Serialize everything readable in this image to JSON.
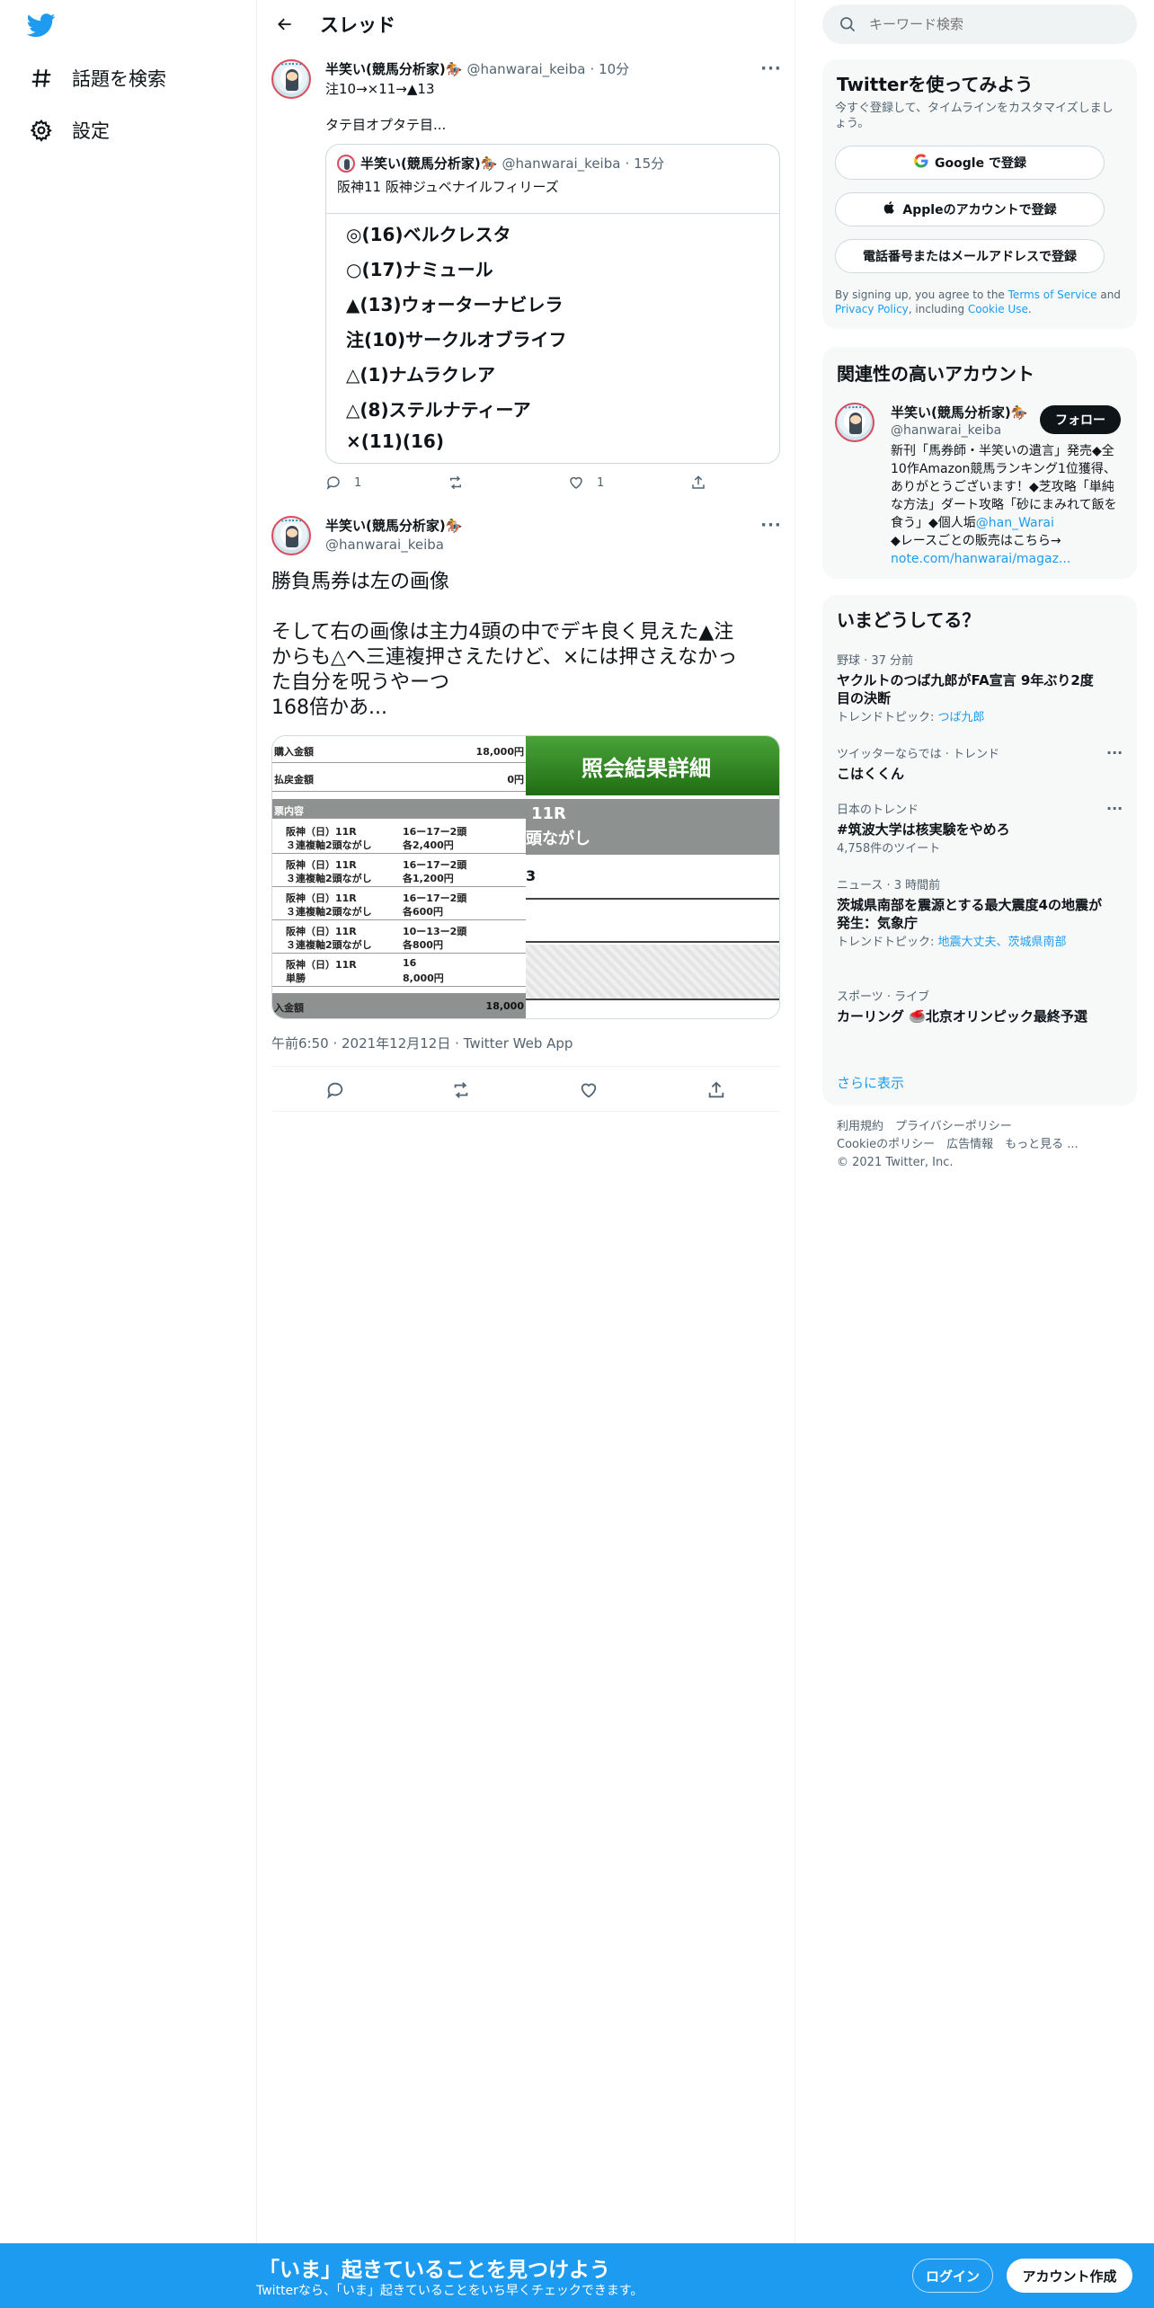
{
  "nav": {
    "explore_label": "話題を検索",
    "settings_label": "設定"
  },
  "header": {
    "title": "スレッド"
  },
  "tweet1": {
    "display_name": "半笑い(競馬分析家)🏇",
    "handle": "@hanwarai_keiba",
    "time": "· 10分",
    "line1": "注10→×11→▲13",
    "line2": "タテ目オプタテ目...",
    "reply_count": "1",
    "like_count": "1",
    "quote": {
      "display_name": "半笑い(競馬分析家)🏇",
      "handle": "@hanwarai_keiba",
      "time": "· 15分",
      "text": "阪神11 阪神ジュベナイルフィリーズ",
      "picks": [
        "◎(16)ベルクレスタ",
        "○(17)ナミュール",
        "▲(13)ウォーターナビレラ",
        "注(10)サークルオブライフ",
        "△(1)ナムラクレア",
        "△(8)ステルナティーア",
        "×(11)(16)"
      ]
    }
  },
  "tweet2": {
    "display_name": "半笑い(競馬分析家)🏇",
    "handle": "@hanwarai_keiba",
    "body": [
      "勝負馬券は左の画像",
      "",
      "そして右の画像は主力4頭の中でデキ良く見えた▲注",
      "からも△へ三連複押さえたけど、×には押さえなかっ",
      "た自分を呪うやーつ",
      "168倍かあ..."
    ],
    "timestamp": "午前6:50 · 2021年12月12日 · Twitter Web App",
    "media": {
      "left": {
        "purchase_label": "購入金額",
        "purchase_value": "18,000円",
        "payout_label": "払戻金額",
        "payout_value": "0円",
        "section_label": "票内容",
        "rows": [
          {
            "race": "阪神（日）11R",
            "bet": "３連複軸2頭ながし",
            "combo": "16ー17ー2頭",
            "amount": "各2,400円"
          },
          {
            "race": "阪神（日）11R",
            "bet": "３連複軸2頭ながし",
            "combo": "16ー17ー2頭",
            "amount": "各1,200円"
          },
          {
            "race": "阪神（日）11R",
            "bet": "３連複軸2頭ながし",
            "combo": "16ー17ー2頭",
            "amount": "各600円"
          },
          {
            "race": "阪神（日）11R",
            "bet": "３連複軸2頭ながし",
            "combo": "10ー13ー2頭",
            "amount": "各800円"
          },
          {
            "race": "阪神（日）11R",
            "bet": "単勝",
            "combo": "16",
            "amount": "8,000円"
          }
        ],
        "total_label": "入金額",
        "total_value": "18,000"
      },
      "right": {
        "title": "照会結果詳細",
        "line1": "11R",
        "line2": "頭ながし",
        "cell": "3"
      }
    }
  },
  "sidebar": {
    "search_placeholder": "キーワード検索",
    "signup": {
      "title": "Twitterを使ってみよう",
      "desc": "今すぐ登録して、タイムラインをカスタマイズしましょう。",
      "google": "Google で登録",
      "apple": "Appleのアカウントで登録",
      "phone": "電話番号またはメールアドレスで登録",
      "legal_pre": "By signing up, you agree to the ",
      "legal_terms": "Terms of Service",
      "legal_mid": " and ",
      "legal_privacy": "Privacy Policy",
      "legal_mid2": ", including ",
      "legal_cookie": "Cookie Use",
      "legal_end": "."
    },
    "related": {
      "title": "関連性の高いアカウント",
      "display_name": "半笑い(競馬分析家)🏇",
      "handle": "@hanwarai_keiba",
      "follow": "フォロー",
      "bio1": "新刊「馬券師・半笑いの遺言」発売◆全10作Amazon競馬ランキング1位獲得、ありがとうございます！◆芝攻略「単純な方法」ダート攻略「砂にまみれて飯を食う」◆個人垢",
      "bio_link": "@han_Warai",
      "bio2": "◆レースごとの販売はこちら→",
      "bio_url": "note.com/hanwarai/magaz..."
    },
    "trends": {
      "title": "いまどうしてる？",
      "items": [
        {
          "cat": "野球 · 37 分前",
          "title": "ヤクルトのつば九郎がFA宣言 9年ぶり2度目の決断",
          "sub_pre": "トレンドトピック: ",
          "sub_links": "つば九郎"
        },
        {
          "cat": "ツイッターならでは · トレンド",
          "title": "こはくくん"
        },
        {
          "cat": "日本のトレンド",
          "title": "#筑波大学は核実験をやめろ",
          "sub": "4,758件のツイート"
        },
        {
          "cat": "ニュース · 3 時間前",
          "title": "茨城県南部を震源とする最大震度4の地震が発生：気象庁",
          "sub_pre": "トレンドトピック: ",
          "sub_links": "地震大丈夫、茨城県南部"
        },
        {
          "cat": "スポーツ · ライブ",
          "title": "カーリング 🥌北京オリンピック最終予選"
        }
      ],
      "show_more": "さらに表示"
    },
    "footer": {
      "line1": "利用規約　プライバシーポリシー",
      "line2": "Cookieのポリシー　広告情報　もっと見る ...",
      "line3": "© 2021 Twitter, Inc."
    }
  },
  "bottombar": {
    "headline": "「いま」起きていることを見つけよう",
    "sub": "Twitterなら、「いま」起きていることをいち早くチェックできます。",
    "login": "ログイン",
    "signup": "アカウント作成"
  },
  "colors": {
    "accent": "#1d9bf0",
    "text": "#0f1419",
    "muted": "#536471",
    "border": "#cfd9de",
    "ticket_green": "#2f8a1f"
  }
}
